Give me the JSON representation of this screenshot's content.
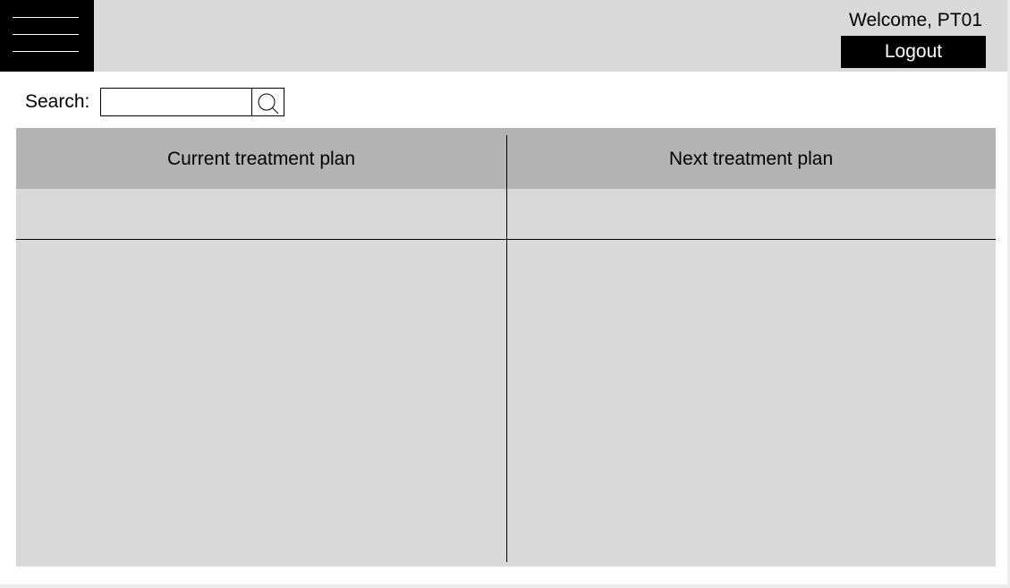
{
  "header": {
    "welcome_text": "Welcome, PT01",
    "logout_label": "Logout"
  },
  "search": {
    "label": "Search:",
    "value": "",
    "placeholder": ""
  },
  "table": {
    "columns": [
      "Current treatment plan",
      "Next treatment plan"
    ],
    "rows": [
      [
        "",
        ""
      ],
      [
        "",
        ""
      ]
    ]
  },
  "colors": {
    "header_bg": "#d9d9d9",
    "table_header_bg": "#b3b3b3",
    "table_body_bg": "#d9d9d9",
    "button_bg": "#000000",
    "button_text": "#ffffff"
  },
  "icons": {
    "menu": "hamburger-menu-icon",
    "search": "search-icon"
  }
}
